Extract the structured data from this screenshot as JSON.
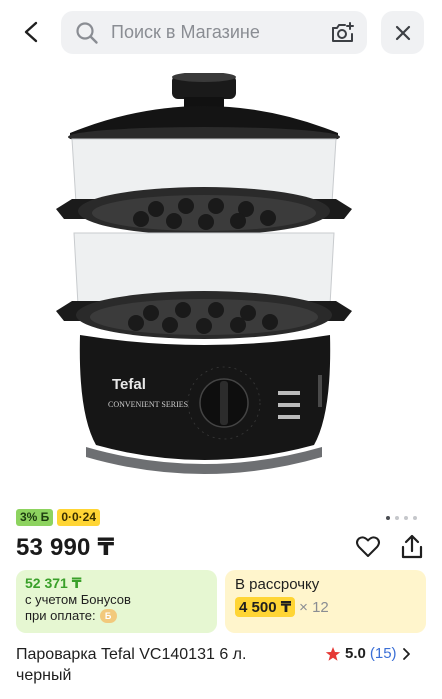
{
  "header": {
    "search_placeholder": "Поиск в Магазине"
  },
  "badges": {
    "cashback": "3% Б",
    "installment_plan": "0·0·24"
  },
  "gallery": {
    "total_dots": 4,
    "active_index": 0
  },
  "product": {
    "price": "53 990 ₸",
    "title": "Пароварка Tefal VC140131 6 л. черный",
    "image_brand": "Tefal",
    "image_series": "CONVENIENT SERIES"
  },
  "bonus": {
    "amount": "52 371 ₸",
    "line1": "с учетом Бонусов",
    "line2": "при оплате:",
    "coin_symbol": "Б"
  },
  "installment": {
    "label": "В рассрочку",
    "amount": "4 500 ₸",
    "multiplier": "× 12"
  },
  "rating": {
    "value": "5.0",
    "count": "(15)"
  },
  "colors": {
    "accent_green": "#3aa02a",
    "badge_green": "#8dd35f",
    "badge_yellow": "#ffd534",
    "rating_star": "#e53935",
    "link_blue": "#3b6fd6"
  },
  "icons": [
    "back-arrow-icon",
    "search-icon",
    "camera-search-icon",
    "close-icon",
    "heart-icon",
    "share-icon",
    "star-icon",
    "chevron-right-icon"
  ]
}
